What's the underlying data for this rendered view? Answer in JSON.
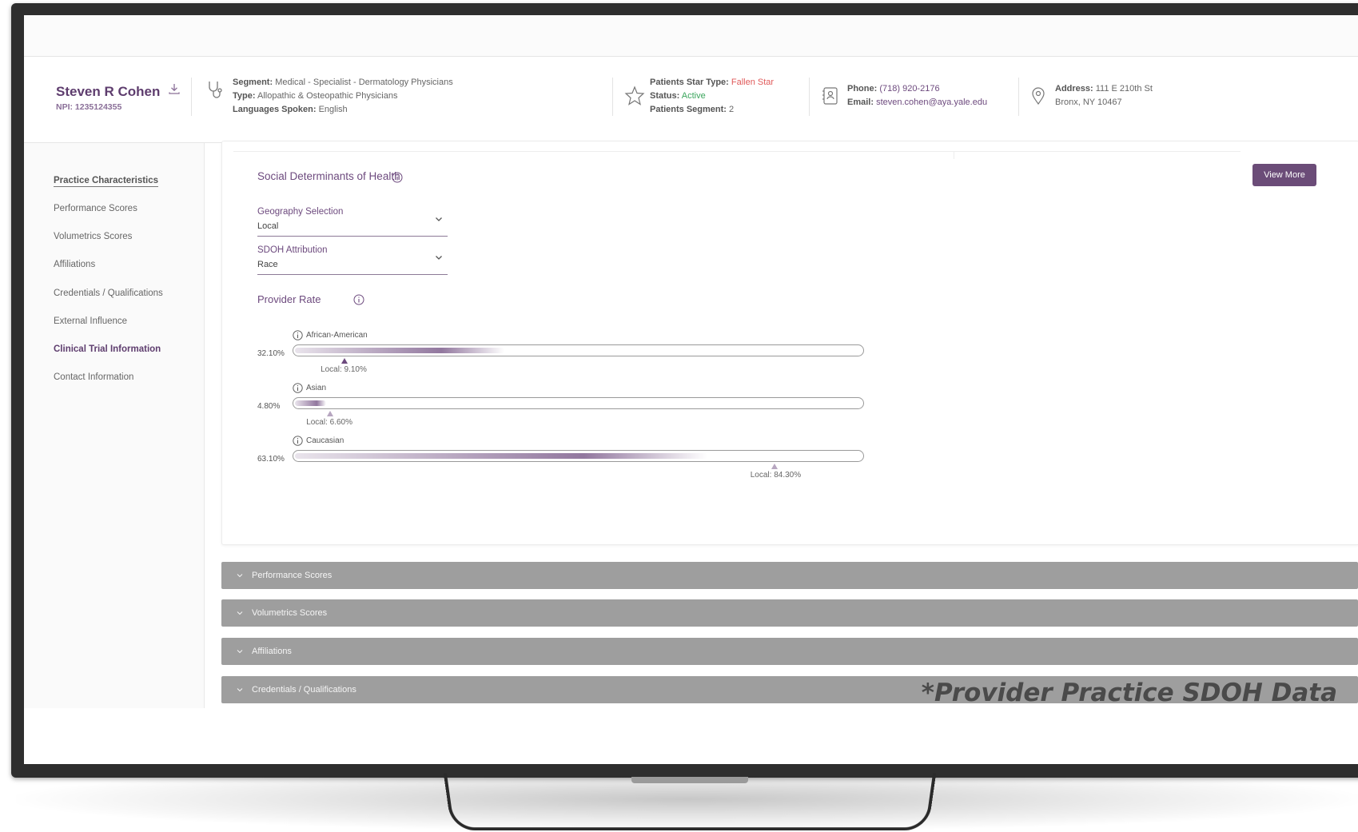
{
  "provider": {
    "name": "Steven R Cohen",
    "npi": "NPI: 1235124355"
  },
  "header": {
    "segment_label": "Segment:",
    "segment_value": "Medical - Specialist - Dermatology Physicians",
    "type_label": "Type:",
    "type_value": "Allopathic & Osteopathic Physicians",
    "languages_label": "Languages Spoken:",
    "languages_value": "English",
    "star_type_label": "Patients Star Type:",
    "star_type_value": "Fallen Star",
    "status_label": "Status:",
    "status_value": "Active",
    "patients_segment_label": "Patients Segment:",
    "patients_segment_value": "2",
    "phone_label": "Phone:",
    "phone_value": "(718) 920-2176",
    "email_label": "Email:",
    "email_value": "steven.cohen@aya.yale.edu",
    "address_label": "Address:",
    "address_line1": "111 E 210th St",
    "address_line2": "Bronx, NY 10467"
  },
  "sidebar": {
    "items": [
      {
        "label": "Practice Characteristics"
      },
      {
        "label": "Performance Scores"
      },
      {
        "label": "Volumetrics Scores"
      },
      {
        "label": "Affiliations"
      },
      {
        "label": "Credentials / Qualifications"
      },
      {
        "label": "External Influence"
      },
      {
        "label": "Clinical Trial Information"
      },
      {
        "label": "Contact Information"
      }
    ]
  },
  "sdoh": {
    "title": "Social Determinants of Health",
    "view_more": "View More",
    "geography": {
      "label": "Geography Selection",
      "value": "Local"
    },
    "attribution": {
      "label": "SDOH Attribution",
      "value": "Race"
    },
    "provider_rate_title": "Provider Rate",
    "rates": [
      {
        "category": "African-American",
        "provider_pct": "32.10%",
        "provider_value": 32.1,
        "local_label": "Local: 9.10%",
        "local_value": 9.1
      },
      {
        "category": "Asian",
        "provider_pct": "4.80%",
        "provider_value": 4.8,
        "local_label": "Local: 6.60%",
        "local_value": 6.6
      },
      {
        "category": "Caucasian",
        "provider_pct": "63.10%",
        "provider_value": 63.1,
        "local_label": "Local: 84.30%",
        "local_value": 84.3
      }
    ]
  },
  "accordions": [
    {
      "label": "Performance Scores"
    },
    {
      "label": "Volumetrics Scores"
    },
    {
      "label": "Affiliations"
    },
    {
      "label": "Credentials / Qualifications"
    }
  ],
  "caption": "*Provider Practice SDOH Data",
  "colors": {
    "brand_purple": "#6b4c78",
    "status_red": "#e05a5a",
    "status_green": "#3aa55c",
    "accordion_grey": "#9e9e9e"
  }
}
